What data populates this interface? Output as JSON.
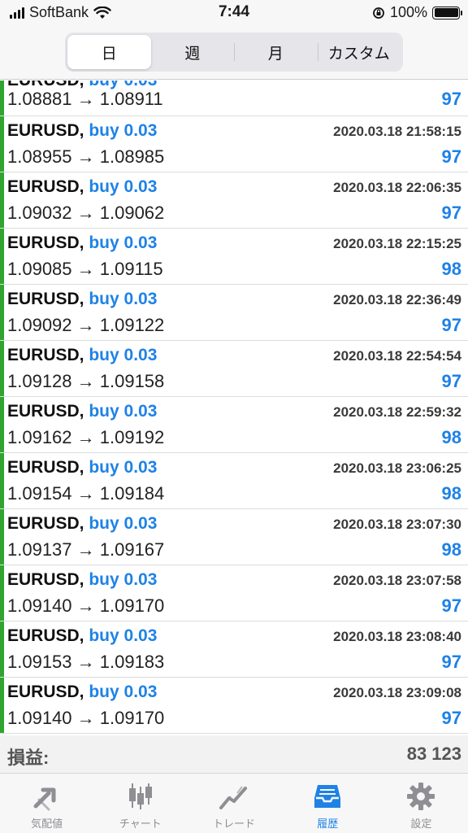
{
  "status": {
    "carrier": "SoftBank",
    "time": "7:44",
    "battery": "100%"
  },
  "segments": [
    "日",
    "週",
    "月",
    "カスタム"
  ],
  "active_segment": 0,
  "partial_row": {
    "symbol": "EURUSD,",
    "direction": "buy 0.03",
    "prices": "1.08881 → 1.08911",
    "profit": "97"
  },
  "trades": [
    {
      "symbol": "EURUSD,",
      "direction": "buy 0.03",
      "time": "2020.03.18 21:58:15",
      "prices": "1.08955 → 1.08985",
      "profit": "97"
    },
    {
      "symbol": "EURUSD,",
      "direction": "buy 0.03",
      "time": "2020.03.18 22:06:35",
      "prices": "1.09032 → 1.09062",
      "profit": "97"
    },
    {
      "symbol": "EURUSD,",
      "direction": "buy 0.03",
      "time": "2020.03.18 22:15:25",
      "prices": "1.09085 → 1.09115",
      "profit": "98"
    },
    {
      "symbol": "EURUSD,",
      "direction": "buy 0.03",
      "time": "2020.03.18 22:36:49",
      "prices": "1.09092 → 1.09122",
      "profit": "97"
    },
    {
      "symbol": "EURUSD,",
      "direction": "buy 0.03",
      "time": "2020.03.18 22:54:54",
      "prices": "1.09128 → 1.09158",
      "profit": "97"
    },
    {
      "symbol": "EURUSD,",
      "direction": "buy 0.03",
      "time": "2020.03.18 22:59:32",
      "prices": "1.09162 → 1.09192",
      "profit": "98"
    },
    {
      "symbol": "EURUSD,",
      "direction": "buy 0.03",
      "time": "2020.03.18 23:06:25",
      "prices": "1.09154 → 1.09184",
      "profit": "98"
    },
    {
      "symbol": "EURUSD,",
      "direction": "buy 0.03",
      "time": "2020.03.18 23:07:30",
      "prices": "1.09137 → 1.09167",
      "profit": "98"
    },
    {
      "symbol": "EURUSD,",
      "direction": "buy 0.03",
      "time": "2020.03.18 23:07:58",
      "prices": "1.09140 → 1.09170",
      "profit": "97"
    },
    {
      "symbol": "EURUSD,",
      "direction": "buy 0.03",
      "time": "2020.03.18 23:08:40",
      "prices": "1.09153 → 1.09183",
      "profit": "97"
    },
    {
      "symbol": "EURUSD,",
      "direction": "buy 0.03",
      "time": "2020.03.18 23:09:08",
      "prices": "1.09140 → 1.09170",
      "profit": "97"
    }
  ],
  "summary": {
    "label": "損益:",
    "value": "83 123"
  },
  "tabs": [
    {
      "label": "気配値",
      "icon": "quotes-icon"
    },
    {
      "label": "チャート",
      "icon": "chart-icon"
    },
    {
      "label": "トレード",
      "icon": "trade-icon"
    },
    {
      "label": "履歴",
      "icon": "history-icon"
    },
    {
      "label": "設定",
      "icon": "settings-icon"
    }
  ],
  "active_tab": 3,
  "colors": {
    "accent": "#1e82e6",
    "buy_bar": "#2fa52f",
    "inactive": "#8e8e93"
  }
}
